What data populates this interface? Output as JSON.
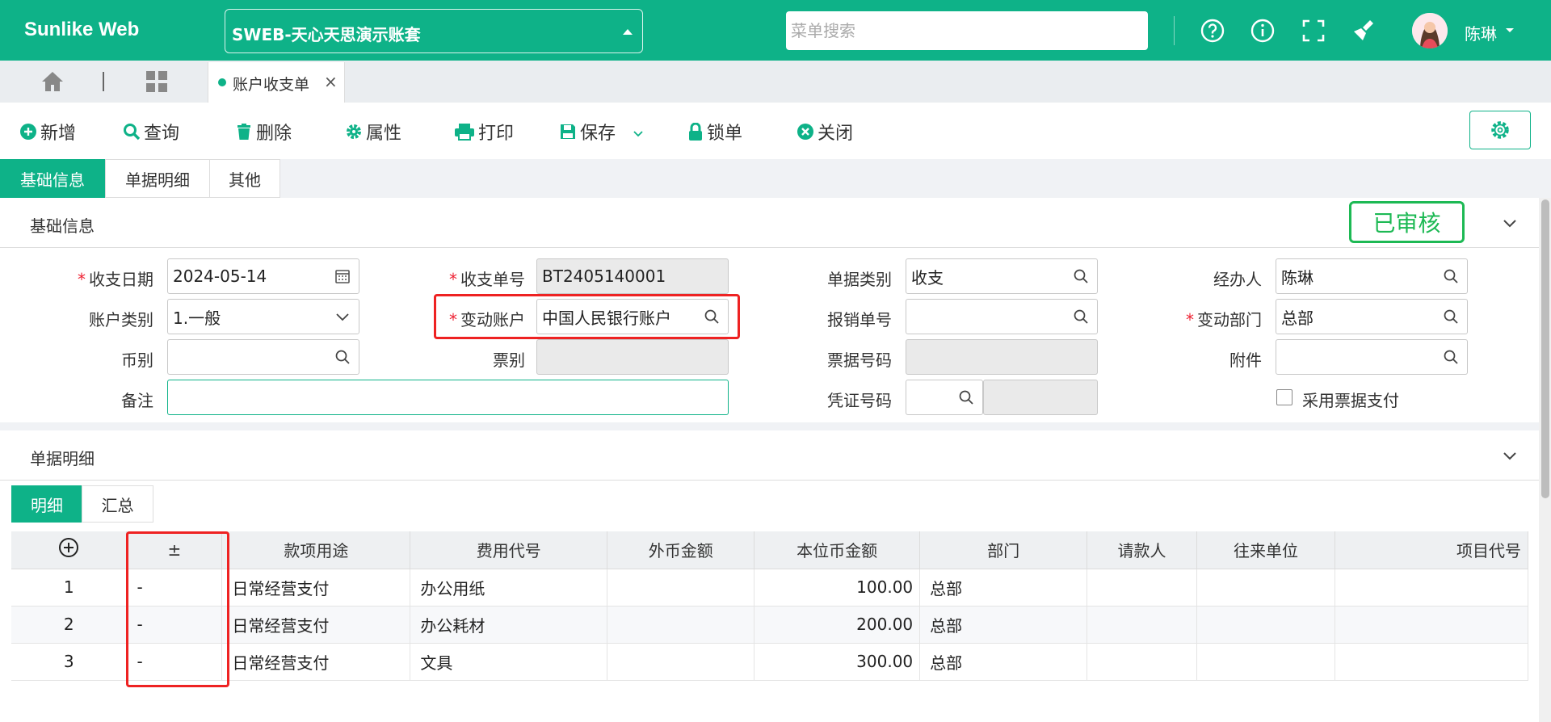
{
  "topbar": {
    "brand": "Sunlike Web",
    "account": "SWEB-天心天思演示账套",
    "search_placeholder": "菜单搜索",
    "username": "陈琳"
  },
  "tabbar": {
    "page_tab": "账户收支单"
  },
  "toolbar": {
    "new": "新增",
    "query": "查询",
    "delete": "删除",
    "properties": "属性",
    "print": "打印",
    "save": "保存",
    "lock": "锁单",
    "close": "关闭"
  },
  "main_tabs": [
    "基础信息",
    "单据明细",
    "其他"
  ],
  "basic": {
    "title": "基础信息",
    "status": "已审核",
    "fields": {
      "date_label": "收支日期",
      "date_value": "2024-05-14",
      "bill_no_label": "收支单号",
      "bill_no_value": "BT2405140001",
      "bill_type_label": "单据类别",
      "bill_type_value": "收支",
      "handler_label": "经办人",
      "handler_value": "陈琳",
      "acct_type_label": "账户类别",
      "acct_type_value": "1.一般",
      "change_acct_label": "变动账户",
      "change_acct_value": "中国人民银行账户",
      "reimb_no_label": "报销单号",
      "reimb_no_value": "",
      "dept_label": "变动部门",
      "dept_value": "总部",
      "currency_label": "币别",
      "currency_value": "",
      "note_type_label": "票别",
      "note_type_value": "",
      "note_no_label": "票据号码",
      "note_no_value": "",
      "attach_label": "附件",
      "attach_value": "",
      "remark_label": "备注",
      "remark_value": "",
      "voucher_label": "凭证号码",
      "voucher_value": "",
      "use_note_pay_label": "采用票据支付"
    }
  },
  "detail": {
    "title": "单据明细",
    "subtabs": [
      "明细",
      "汇总"
    ],
    "columns": [
      "",
      "±",
      "款项用途",
      "费用代号",
      "外币金额",
      "本位币金额",
      "部门",
      "请款人",
      "往来单位",
      "项目代号"
    ],
    "rows": [
      {
        "no": "1",
        "pm": "-",
        "purpose": "日常经营支付",
        "expense": "办公用纸",
        "foreign": "",
        "local": "100.00",
        "dept": "总部",
        "requester": "",
        "partner": "",
        "project": ""
      },
      {
        "no": "2",
        "pm": "-",
        "purpose": "日常经营支付",
        "expense": "办公耗材",
        "foreign": "",
        "local": "200.00",
        "dept": "总部",
        "requester": "",
        "partner": "",
        "project": ""
      },
      {
        "no": "3",
        "pm": "-",
        "purpose": "日常经营支付",
        "expense": "文具",
        "foreign": "",
        "local": "300.00",
        "dept": "总部",
        "requester": "",
        "partner": "",
        "project": ""
      }
    ]
  },
  "colors": {
    "accent": "#0eb288",
    "status_green": "#1db954",
    "highlight_red": "#e22222"
  }
}
